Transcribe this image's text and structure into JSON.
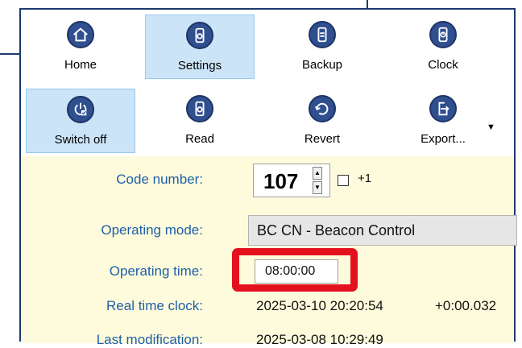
{
  "toolbar_row1": [
    {
      "label": "Home",
      "icon": "home-icon"
    },
    {
      "label": "Settings",
      "icon": "settings-icon"
    },
    {
      "label": "Backup",
      "icon": "backup-icon"
    },
    {
      "label": "Clock",
      "icon": "clock-icon"
    }
  ],
  "toolbar_row2": [
    {
      "label": "Switch off",
      "icon": "switch-off-icon"
    },
    {
      "label": "Read",
      "icon": "read-icon"
    },
    {
      "label": "Revert",
      "icon": "revert-icon"
    },
    {
      "label": "Export...",
      "icon": "export-icon"
    }
  ],
  "form": {
    "code_number_label": "Code number:",
    "code_number_value": "107",
    "plus_one_label": "+1",
    "plus_one_checked": false,
    "operating_mode_label": "Operating mode:",
    "operating_mode_value": "BC CN - Beacon Control",
    "operating_time_label": "Operating time:",
    "operating_time_value": "08:00:00",
    "real_time_clock_label": "Real time clock:",
    "real_time_clock_value": "2025-03-10 20:20:54",
    "real_time_clock_offset": "+0:00.032",
    "last_modification_label": "Last modification:",
    "last_modification_value": "2025-03-08 10:29:49"
  },
  "colors": {
    "accent": "#2f4f8f",
    "label_blue": "#1f5fa8",
    "highlight": "#e3111e",
    "form_background": "#fdfbdc",
    "active_button": "#cce4f7"
  }
}
